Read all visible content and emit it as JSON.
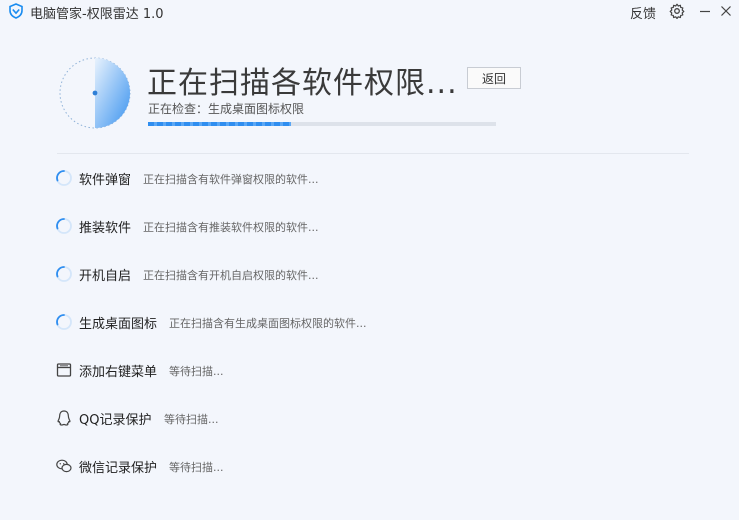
{
  "window": {
    "title": "电脑管家-权限雷达 1.0",
    "feedback_label": "反馈",
    "logo_icon": "shield-icon",
    "settings_icon": "gear-icon",
    "minimize_icon": "minimize-icon",
    "close_icon": "close-icon"
  },
  "scan": {
    "title": "正在扫描各软件权限...",
    "back_label": "返回",
    "current_check": "正在检查：生成桌面图标权限",
    "progress": 0.41,
    "radar_icon": "radar-icon"
  },
  "colors": {
    "background": "#f3f6fc",
    "accent": "#2f8ef0",
    "progress_track": "#dde2ea"
  },
  "items": [
    {
      "icon": "spinner-icon",
      "label": "软件弹窗",
      "status": "正在扫描含有软件弹窗权限的软件..."
    },
    {
      "icon": "spinner-icon",
      "label": "推装软件",
      "status": "正在扫描含有推装软件权限的软件..."
    },
    {
      "icon": "spinner-icon",
      "label": "开机自启",
      "status": "正在扫描含有开机自启权限的软件..."
    },
    {
      "icon": "spinner-icon",
      "label": "生成桌面图标",
      "status": "正在扫描含有生成桌面图标权限的软件..."
    },
    {
      "icon": "context-menu-icon",
      "label": "添加右键菜单",
      "status": "等待扫描..."
    },
    {
      "icon": "qq-icon",
      "label": "QQ记录保护",
      "status": "等待扫描..."
    },
    {
      "icon": "wechat-icon",
      "label": "微信记录保护",
      "status": "等待扫描..."
    }
  ]
}
